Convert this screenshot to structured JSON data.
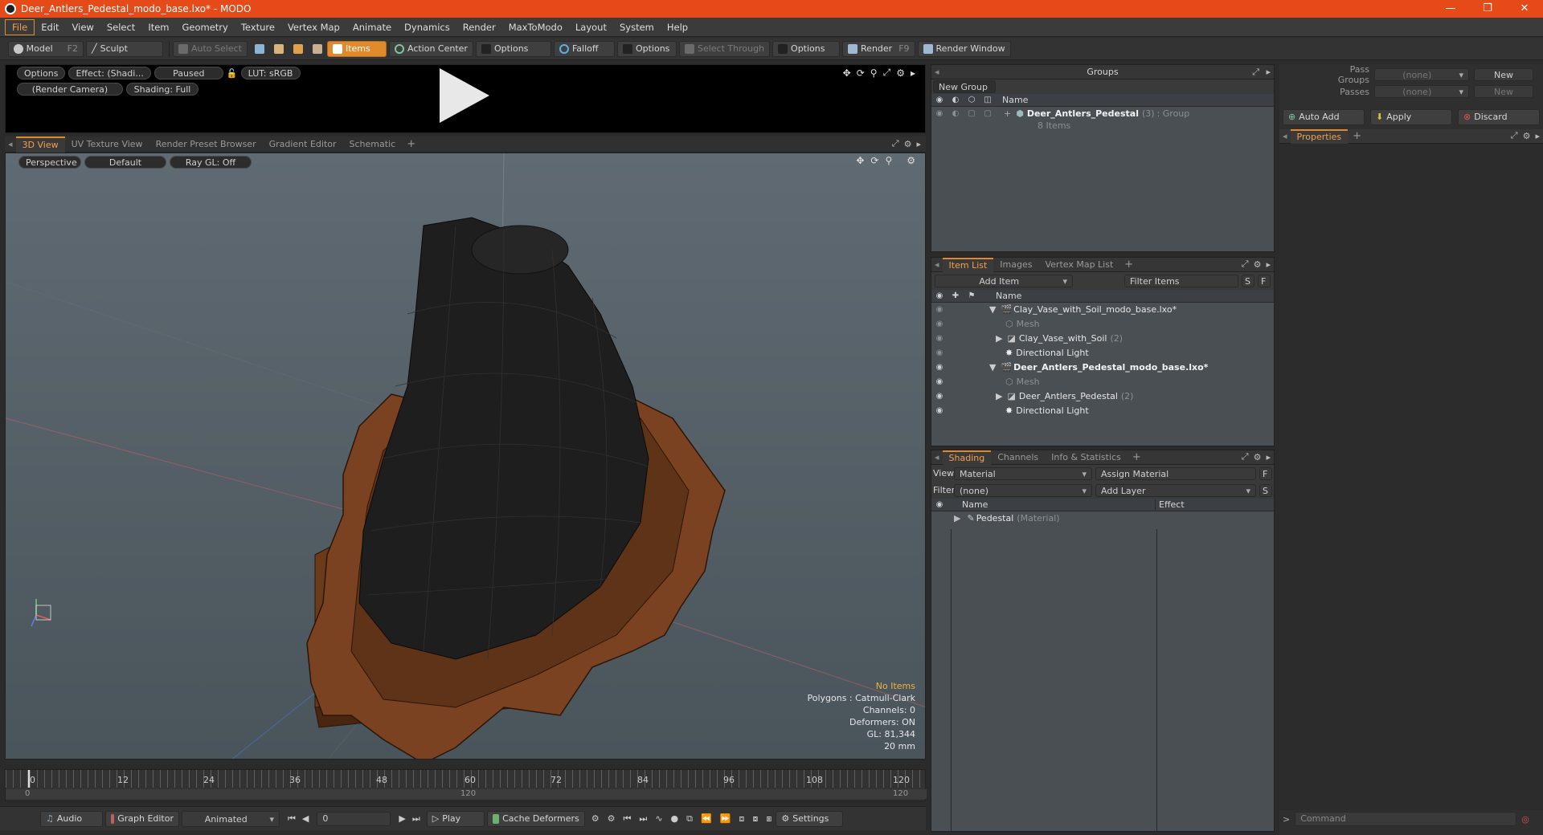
{
  "window": {
    "title": "Deer_Antlers_Pedestal_modo_base.lxo* - MODO",
    "controls": [
      "—",
      "❐",
      "✕"
    ]
  },
  "menu": [
    "File",
    "Edit",
    "View",
    "Select",
    "Item",
    "Geometry",
    "Texture",
    "Vertex Map",
    "Animate",
    "Dynamics",
    "Render",
    "MaxToModo",
    "Layout",
    "System",
    "Help"
  ],
  "toolbar": {
    "model": "Model",
    "model_key": "F2",
    "sculpt": "Sculpt",
    "auto_select": "Auto Select",
    "items": "Items",
    "action_center": "Action Center",
    "options1": "Options",
    "falloff": "Falloff",
    "options2": "Options",
    "select_through": "Select Through",
    "options3": "Options",
    "render": "Render",
    "render_key": "F9",
    "render_window": "Render Window"
  },
  "preview": {
    "options": "Options",
    "effect": "Effect: (Shadi...",
    "paused": "Paused",
    "lut": "LUT: sRGB",
    "camera": "(Render Camera)",
    "shading": "Shading: Full"
  },
  "viewport_tabs": [
    "3D View",
    "UV Texture View",
    "Render Preset Browser",
    "Gradient Editor",
    "Schematic"
  ],
  "viewport": {
    "projection": "Perspective",
    "style": "Default",
    "raygl": "Ray GL: Off",
    "info": {
      "no_items": "No Items",
      "polygons": "Polygons : Catmull-Clark",
      "channels": "Channels: 0",
      "deformers": "Deformers: ON",
      "gl": "GL: 81,344",
      "size": "20 mm"
    }
  },
  "timeline": {
    "ticks": [
      "0",
      "12",
      "24",
      "36",
      "48",
      "60",
      "72",
      "84",
      "96",
      "108",
      "120"
    ],
    "sub_start": "0",
    "sub_mid": "120",
    "sub_end": "120"
  },
  "bottombar": {
    "audio": "Audio",
    "graph_editor": "Graph Editor",
    "animated": "Animated",
    "frame": "0",
    "play": "Play",
    "cache": "Cache Deformers",
    "settings": "Settings"
  },
  "groups": {
    "title": "Groups",
    "new_group": "New Group",
    "col_name": "Name",
    "group_name": "Deer_Antlers_Pedestal",
    "group_count": "(3)",
    "group_type": ": Group",
    "group_items": "8 Items"
  },
  "item_list": {
    "tabs": [
      "Item List",
      "Images",
      "Vertex Map List"
    ],
    "add_item": "Add Item",
    "filter": "Filter Items",
    "s": "S",
    "f": "F",
    "col_name": "Name",
    "rows": [
      {
        "label": "Clay_Vase_with_Soil_modo_base.lxo*",
        "extra": ""
      },
      {
        "label": "Mesh",
        "extra": ""
      },
      {
        "label": "Clay_Vase_with_Soil",
        "extra": "(2)"
      },
      {
        "label": "Directional Light",
        "extra": ""
      },
      {
        "label": "Deer_Antlers_Pedestal_modo_base.lxo*",
        "extra": ""
      },
      {
        "label": "Mesh",
        "extra": ""
      },
      {
        "label": "Deer_Antlers_Pedestal",
        "extra": "(2)"
      },
      {
        "label": "Directional Light",
        "extra": ""
      }
    ]
  },
  "shading": {
    "tabs": [
      "Shading",
      "Channels",
      "Info & Statistics"
    ],
    "view_label": "View",
    "view_value": "Material",
    "assign": "Assign Material",
    "filter_label": "Filter",
    "filter_value": "(none)",
    "add_layer": "Add Layer",
    "f": "F",
    "s": "S",
    "col_name": "Name",
    "col_effect": "Effect",
    "row_name": "Pedestal",
    "row_type": "(Material)"
  },
  "right": {
    "pass_groups_label": "Pass Groups",
    "pass_groups_value": "(none)",
    "new1": "New",
    "passes_label": "Passes",
    "passes_value": "(none)",
    "new2": "New",
    "auto_add": "Auto Add",
    "apply": "Apply",
    "discard": "Discard",
    "properties": "Properties",
    "command": "Command"
  },
  "colors": {
    "accent": "#e08a2b",
    "title_bar": "#e64a19",
    "wood": "#6b3a1a",
    "mesh": "#1e1e1e"
  }
}
